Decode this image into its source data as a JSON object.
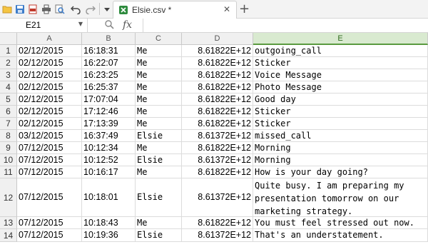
{
  "tab": {
    "label": "Elsie.csv *"
  },
  "formula": {
    "cell_ref": "E21",
    "fx_label": "fx",
    "value": ""
  },
  "columns": [
    "A",
    "B",
    "C",
    "D",
    "E"
  ],
  "active_column": "E",
  "rows": [
    {
      "num": "1",
      "a": "02/12/2015",
      "b": "16:18:31",
      "c": "Me",
      "d": "8.61822E+12",
      "e": "outgoing_call"
    },
    {
      "num": "2",
      "a": "02/12/2015",
      "b": "16:22:07",
      "c": "Me",
      "d": "8.61822E+12",
      "e": "Sticker"
    },
    {
      "num": "3",
      "a": "02/12/2015",
      "b": "16:23:25",
      "c": "Me",
      "d": "8.61822E+12",
      "e": "Voice Message"
    },
    {
      "num": "4",
      "a": "02/12/2015",
      "b": "16:25:37",
      "c": "Me",
      "d": "8.61822E+12",
      "e": "Photo Message"
    },
    {
      "num": "5",
      "a": "02/12/2015",
      "b": "17:07:04",
      "c": "Me",
      "d": "8.61822E+12",
      "e": "Good day"
    },
    {
      "num": "6",
      "a": "02/12/2015",
      "b": "17:12:46",
      "c": "Me",
      "d": "8.61822E+12",
      "e": "Sticker"
    },
    {
      "num": "7",
      "a": "02/12/2015",
      "b": "17:13:39",
      "c": "Me",
      "d": "8.61822E+12",
      "e": "Sticker"
    },
    {
      "num": "8",
      "a": "03/12/2015",
      "b": "16:37:49",
      "c": "Elsie",
      "d": "8.61372E+12",
      "e": "missed_call"
    },
    {
      "num": "9",
      "a": "07/12/2015",
      "b": "10:12:34",
      "c": "Me",
      "d": "8.61822E+12",
      "e": "Morning"
    },
    {
      "num": "10",
      "a": "07/12/2015",
      "b": "10:12:52",
      "c": "Elsie",
      "d": "8.61372E+12",
      "e": "Morning"
    },
    {
      "num": "11",
      "a": "07/12/2015",
      "b": "10:16:17",
      "c": "Me",
      "d": "8.61822E+12",
      "e": "How is your day going?"
    },
    {
      "num": "12",
      "a": "07/12/2015",
      "b": "10:18:01",
      "c": "Elsie",
      "d": "8.61372E+12",
      "e": "Quite busy. I am preparing my presentation tomorrow on our marketing strategy."
    },
    {
      "num": "13",
      "a": "07/12/2015",
      "b": "10:18:43",
      "c": "Me",
      "d": "8.61822E+12",
      "e": "You must feel stressed out now."
    },
    {
      "num": "14",
      "a": "07/12/2015",
      "b": "10:19:36",
      "c": "Elsie",
      "d": "8.61372E+12",
      "e": "That's an understatement."
    }
  ],
  "colors": {
    "accent": "#5a9b3f",
    "header_bg": "#f0f0f0",
    "active_header_bg": "#d9ead0"
  },
  "icons": [
    "save-icon",
    "export-pdf-icon",
    "print-icon",
    "print-preview-icon",
    "undo-icon",
    "redo-icon",
    "dropdown-icon",
    "spreadsheet-tab-icon",
    "close-icon",
    "add-tab-icon"
  ]
}
